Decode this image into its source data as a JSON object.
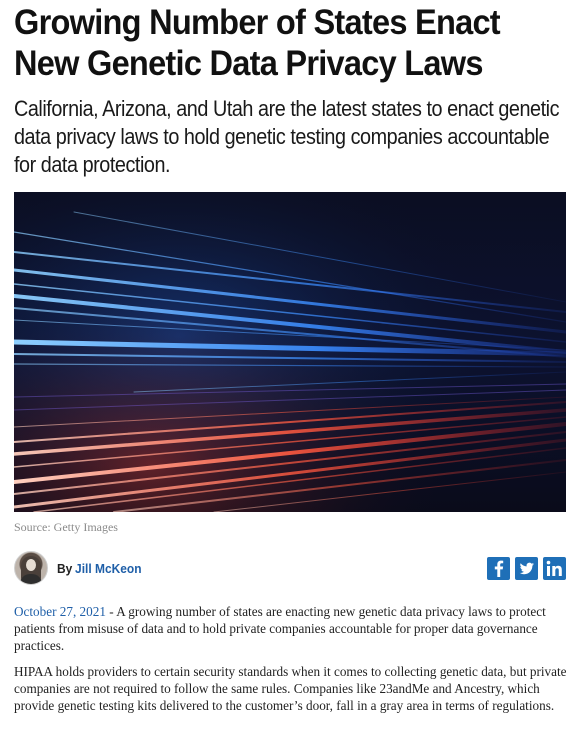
{
  "article": {
    "headline": "Growing Number of States Enact New Genetic Data Privacy Laws",
    "subheadline": "California, Arizona, and Utah are the latest states to enact genetic data privacy laws to hold genetic testing companies accountable for data protection.",
    "image_caption": "Source: Getty Images",
    "byline_prefix": "By",
    "author": "Jill McKeon",
    "date": "October 27, 2021",
    "separator": " - ",
    "paragraph_1_body": "A growing number of states are enacting new genetic data privacy laws to protect patients from misuse of data and to hold private companies accountable for proper data governance practices.",
    "paragraph_2": "HIPAA holds providers to certain security standards when it comes to collecting genetic data, but private companies are not required to follow the same rules. Companies like 23andMe and Ancestry, which provide genetic testing kits delivered to the customer’s door, fall in a gray area in terms of regulations."
  },
  "social": {
    "icons": [
      "facebook-icon",
      "twitter-icon",
      "linkedin-icon"
    ],
    "color": "#1f6fb7"
  },
  "colors": {
    "link": "#1f5fa8",
    "hero_background": "#0a0d1f",
    "hero_blue": "#3fa0ff",
    "hero_red": "#ff4a3a"
  }
}
